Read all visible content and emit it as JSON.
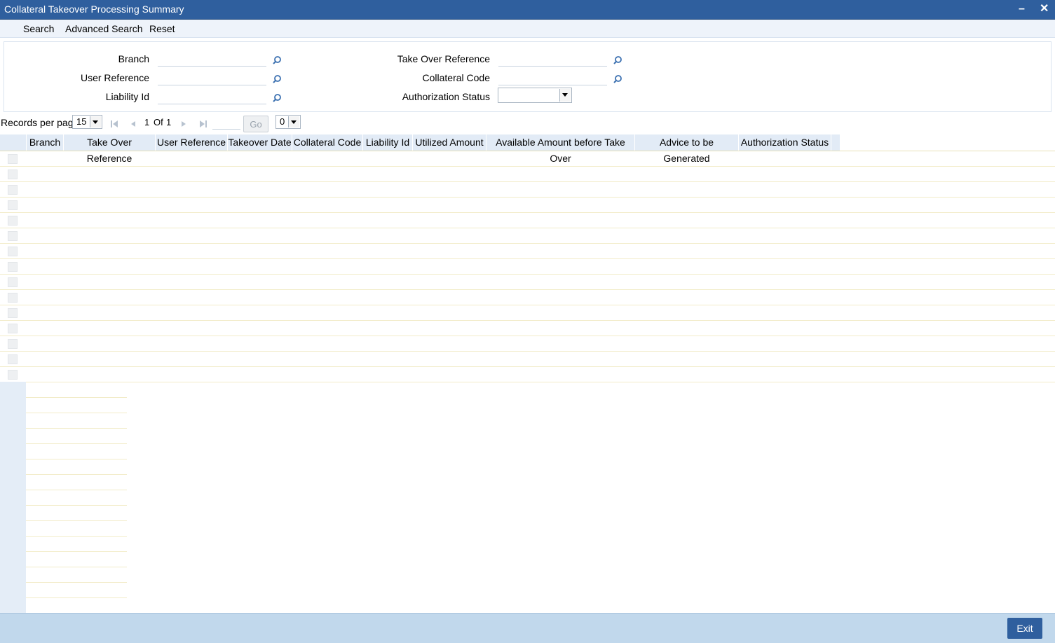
{
  "window": {
    "title": "Collateral Takeover Processing Summary",
    "minimize_glyph": "–",
    "close_glyph": "✕"
  },
  "toolbar": {
    "search": "Search",
    "advanced_search": "Advanced Search",
    "reset": "Reset"
  },
  "criteria": {
    "branch_label": "Branch",
    "user_reference_label": "User Reference",
    "liability_id_label": "Liability Id",
    "take_over_reference_label": "Take Over Reference",
    "collateral_code_label": "Collateral Code",
    "authorization_status_label": "Authorization Status",
    "authorization_status_value": ""
  },
  "pager": {
    "records_per_page_label": "Records per page",
    "records_per_page_value": "15",
    "current_page": "1",
    "of_label": "Of",
    "total_pages": "1",
    "goto_value": "",
    "go_label": "Go",
    "extra_select_value": "0"
  },
  "grid": {
    "columns": [
      "Branch",
      "Take Over Reference",
      "User Reference",
      "Takeover Date",
      "Collateral Code",
      "Liability Id",
      "Utilized Amount",
      "Available Amount before Take Over",
      "Advice to be Generated",
      "Authorization Status"
    ],
    "row_count": 15
  },
  "footer": {
    "exit_label": "Exit"
  },
  "colors": {
    "titlebar": "#2f5f9e",
    "header_cell": "#e2ebf6",
    "footer": "#c1d8ec"
  }
}
